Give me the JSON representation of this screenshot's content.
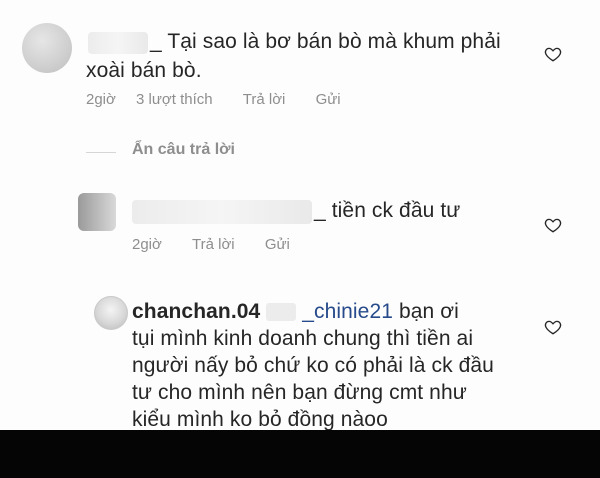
{
  "comments": [
    {
      "text_line1": "_ Tại sao là bơ bán bò mà khum phải",
      "text_line2": "xoài bán bò.",
      "time": "2giờ",
      "likes": "3 lượt thích",
      "reply": "Trả lời",
      "send": "Gửi"
    },
    {
      "text": "_ tiền ck đầu tư",
      "time": "2giờ",
      "reply": "Trả lời",
      "send": "Gửi"
    },
    {
      "username": "chanchan.04",
      "mention": "_chinie21",
      "text_after_mention": "bạn ơi",
      "line2": "tụi mình kinh doanh chung thì tiền ai",
      "line3": "người nấy bỏ chứ ko có phải là ck đầu",
      "line4": "tư cho mình nên bạn đừng cmt như",
      "line5": "kiểu mình ko bỏ đồng nàoo"
    }
  ],
  "hidden_replies_label": "Ẩn câu trả lời",
  "icons": {
    "like": "heart-icon"
  },
  "colors": {
    "meta": "#8e8e8e",
    "text": "#262626",
    "bottom_bar": "#050505"
  }
}
